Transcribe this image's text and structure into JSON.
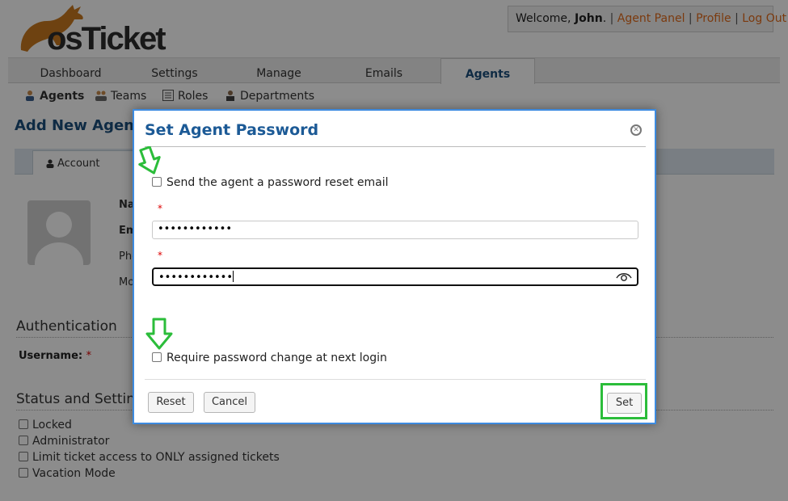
{
  "header": {
    "logo_text": "osTicket",
    "welcome_prefix": "Welcome,",
    "user_name": "John",
    "welcome_suffix": ".",
    "links": [
      "Agent Panel",
      "Profile",
      "Log Out"
    ]
  },
  "main_nav": {
    "tabs": [
      "Dashboard",
      "Settings",
      "Manage",
      "Emails",
      "Agents"
    ],
    "active": "Agents"
  },
  "sub_nav": {
    "items": [
      "Agents",
      "Teams",
      "Roles",
      "Departments"
    ],
    "active": "Agents"
  },
  "page": {
    "title": "Add New Agent",
    "account_tab": "Account",
    "fields": [
      "Na",
      "Em",
      "Pho",
      "Mo"
    ],
    "authentication_heading": "Authentication",
    "username_label": "Username:",
    "required_mark": "*",
    "status_heading": "Status and Settings",
    "status_options": [
      "Locked",
      "Administrator",
      "Limit ticket access to ONLY assigned tickets",
      "Vacation Mode"
    ]
  },
  "dialog": {
    "title": "Set Agent Password",
    "send_reset_label": "Send the agent a password reset email",
    "password_required_mark": "*",
    "password_value": "••••••••••••",
    "confirm_value": "••••••••••••",
    "require_change_label": "Require password change at next login",
    "reset_button": "Reset",
    "cancel_button": "Cancel",
    "set_button": "Set"
  },
  "colors": {
    "accent_link": "#e06a1b",
    "title_blue": "#1c5a96",
    "highlight_green": "#2bbd3a",
    "dialog_border": "#3d8be0"
  }
}
